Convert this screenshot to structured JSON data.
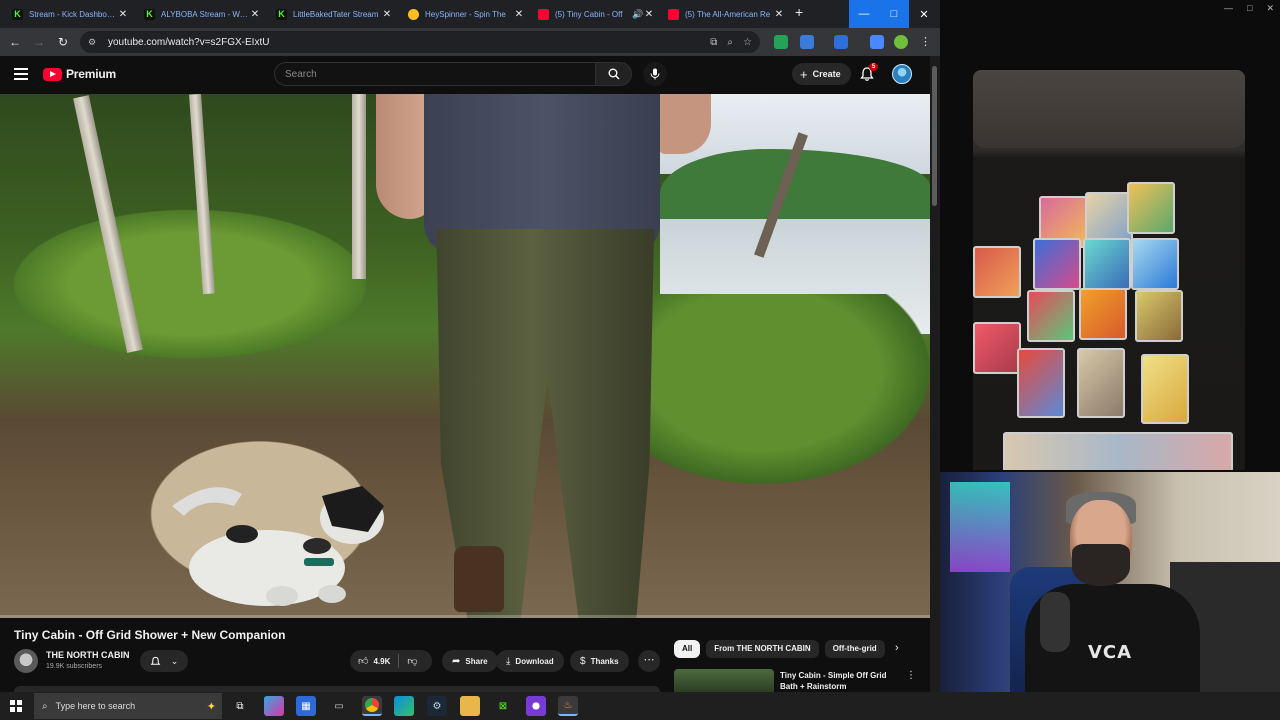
{
  "tabs": [
    {
      "title": "Stream - Kick Dashboard",
      "icon": "kick-icon"
    },
    {
      "title": "ALYBOBA Stream - Watch",
      "icon": "kick-icon"
    },
    {
      "title": "LittleBakedTater Stream",
      "icon": "kick-icon"
    },
    {
      "title": "HeySpinner - Spin The",
      "icon": "heyspinner-icon"
    },
    {
      "title": "(5) Tiny Cabin - Off",
      "icon": "youtube-icon"
    },
    {
      "title": "(5) The All-American Re",
      "icon": "youtube-icon"
    }
  ],
  "new_tab_label": "+",
  "window_controls": {
    "minimize": "—",
    "maximize": "□",
    "close": "✕"
  },
  "toolbar": {
    "back": "←",
    "forward": "→",
    "reload": "↻",
    "url": "youtube.com/watch?v=s2FGX-EIxtU"
  },
  "youtube": {
    "logo_text": "Premium",
    "search_placeholder": "Search",
    "create_label": "Create",
    "notification_count": "5"
  },
  "video": {
    "title": "Tiny Cabin - Off Grid Shower + New Companion",
    "channel_name": "THE NORTH CABIN",
    "subscribers": "19.9K subscribers",
    "likes": "4.9K",
    "share_label": "Share",
    "download_label": "Download",
    "thanks_label": "Thanks",
    "more_label": "⋯"
  },
  "chips": [
    "All",
    "From THE NORTH CABIN",
    "Off-the-grid"
  ],
  "recommendation": {
    "title": "Tiny Cabin - Simple Off Grid Bath + Rainstorm"
  },
  "stream_panel": {
    "shirt_text": "VCA"
  },
  "taskbar": {
    "search_placeholder": "Type here to search"
  },
  "colors": {
    "youtube_red": "#ff0033",
    "kick_green": "#53fc18",
    "chrome_blue": "#1a73e8",
    "bg": "#0f0f0f"
  }
}
